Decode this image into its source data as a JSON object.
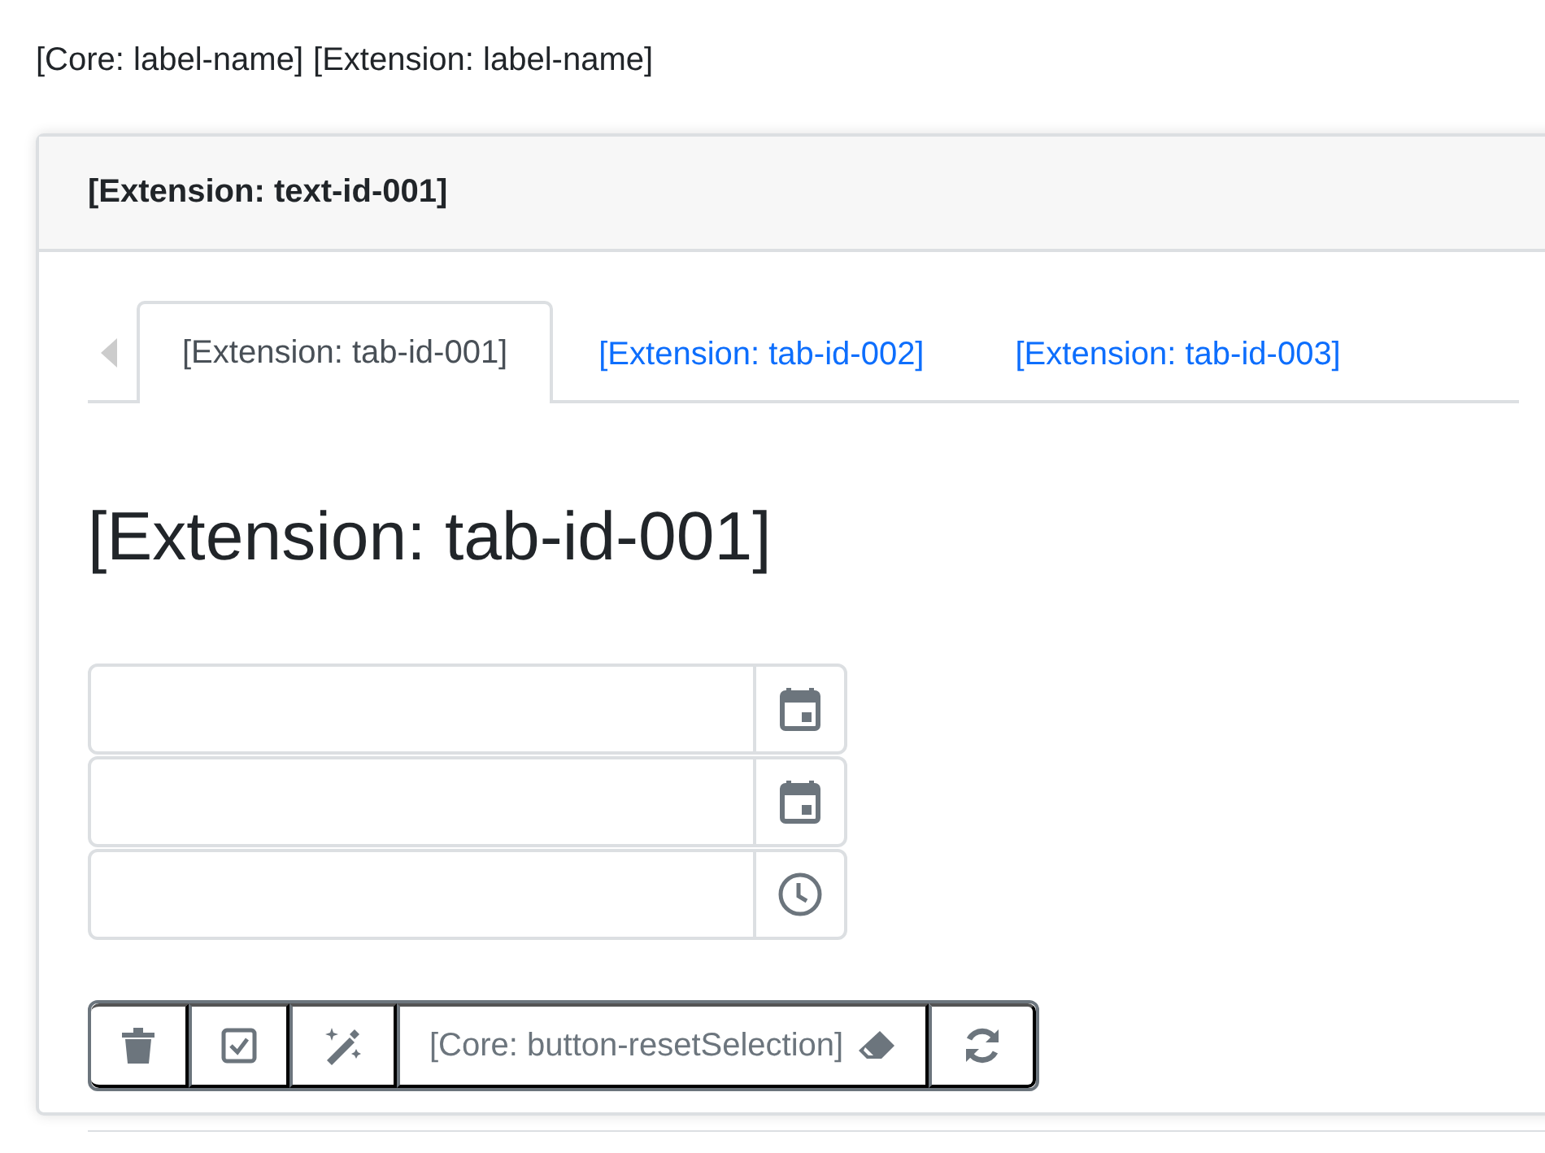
{
  "labels": [
    "[Core: label-name]",
    "[Extension: label-name]"
  ],
  "card": {
    "title": "[Extension: text-id-001]",
    "tabs": [
      {
        "label": "[Extension: tab-id-001]",
        "selected": true
      },
      {
        "label": "[Extension: tab-id-002]",
        "selected": false
      },
      {
        "label": "[Extension: tab-id-003]",
        "selected": false
      }
    ],
    "heading": "[Extension: tab-id-001]",
    "fields": [
      {
        "kind": "date"
      },
      {
        "kind": "date"
      },
      {
        "kind": "time"
      }
    ],
    "toolbar": [
      {
        "kind": "delete"
      },
      {
        "kind": "check"
      },
      {
        "kind": "magic"
      },
      {
        "kind": "reset",
        "label": "[Core: button-resetSelection]"
      },
      {
        "kind": "refresh"
      }
    ]
  }
}
